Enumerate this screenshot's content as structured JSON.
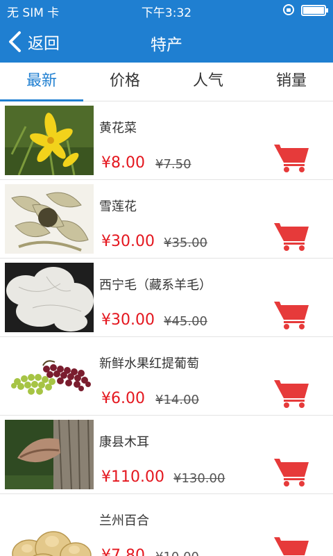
{
  "status_bar": {
    "carrier": "无 SIM 卡",
    "time": "下午3:32"
  },
  "nav": {
    "back_label": "返回",
    "title": "特产"
  },
  "tabs": [
    {
      "label": "最新",
      "active": true
    },
    {
      "label": "价格",
      "active": false
    },
    {
      "label": "人气",
      "active": false
    },
    {
      "label": "销量",
      "active": false
    }
  ],
  "products": [
    {
      "name": "黄花菜",
      "price": "¥8.00",
      "old_price": "¥7.50"
    },
    {
      "name": "雪莲花",
      "price": "¥30.00",
      "old_price": "¥35.00"
    },
    {
      "name": "西宁毛（藏系羊毛）",
      "price": "¥30.00",
      "old_price": "¥45.00"
    },
    {
      "name": "新鲜水果红提葡萄",
      "price": "¥6.00",
      "old_price": "¥14.00"
    },
    {
      "name": "康县木耳",
      "price": "¥110.00",
      "old_price": "¥130.00"
    },
    {
      "name": "兰州百合",
      "price": "¥7.80",
      "old_price": "¥10.00"
    }
  ],
  "colors": {
    "brand": "#1f7fd1",
    "price": "#e4171f",
    "cart": "#e63a3a"
  }
}
